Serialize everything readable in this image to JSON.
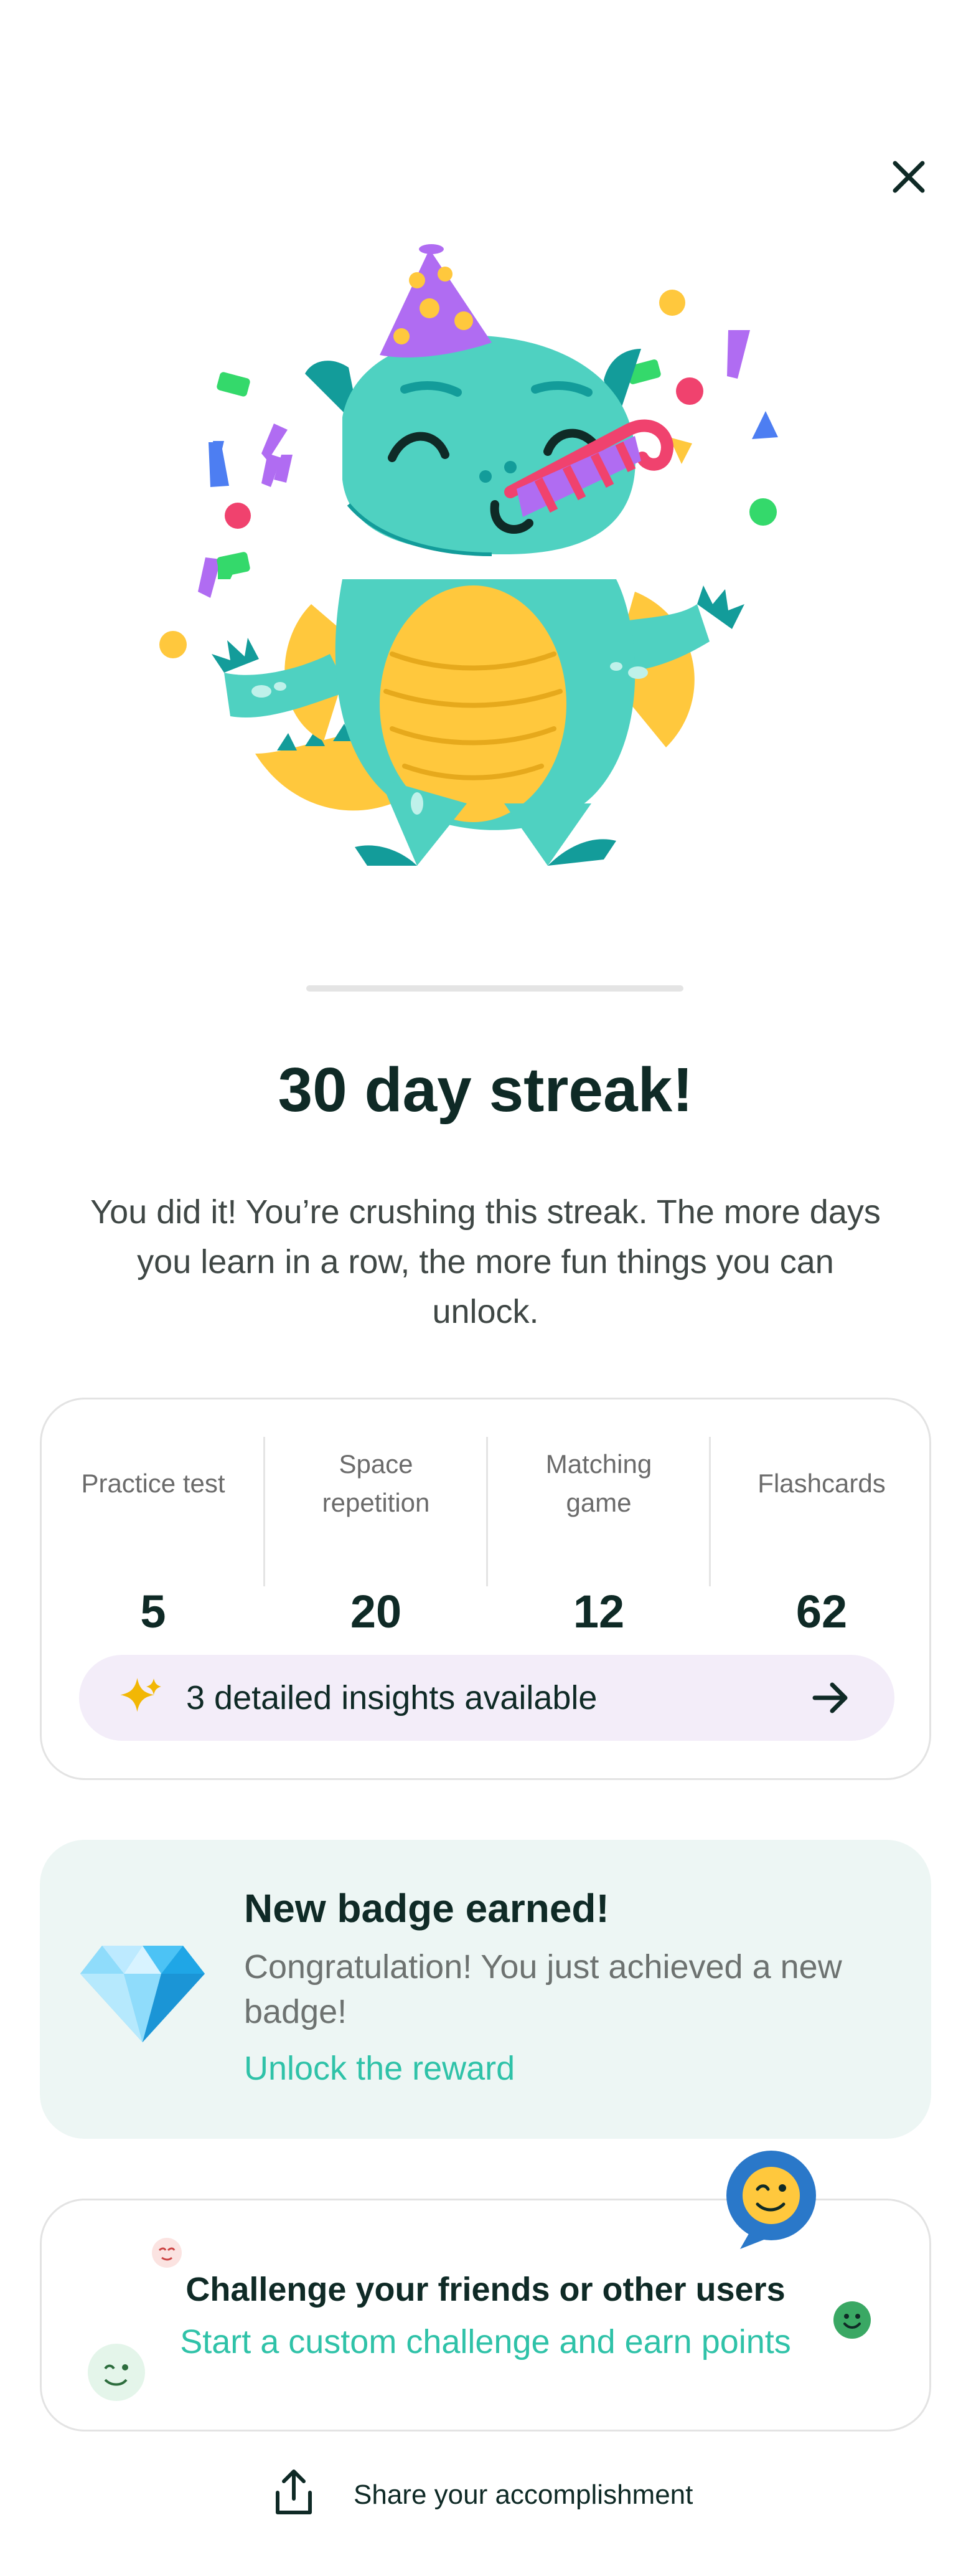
{
  "screen": {
    "title": "30 day streak!",
    "subtitle": "You did it! You’re crushing this streak. The more days you learn in a row, the more fun things you can unlock."
  },
  "icons": {
    "close": "close-icon",
    "mascot": "party-dragon-illustration",
    "sparkle": "sparkles-icon",
    "arrow": "arrow-right-icon",
    "gem": "diamond-icon",
    "share": "share-icon"
  },
  "stats": [
    {
      "label": "Practice test",
      "value": "5"
    },
    {
      "label": "Space repetition",
      "value": "20"
    },
    {
      "label": "Matching game",
      "value": "12"
    },
    {
      "label": "Flashcards",
      "value": "62"
    }
  ],
  "insights": {
    "label": "3 detailed insights available"
  },
  "badge": {
    "heading": "New badge earned!",
    "body": "Congratulation! You just achieved a new badge!",
    "link": "Unlock the reward"
  },
  "challenge": {
    "heading": "Challenge your friends or other users",
    "sub": "Start a custom challenge and earn points"
  },
  "share": {
    "label": "Share your accomplishment"
  },
  "colors": {
    "accent_teal": "#2fc2a8",
    "mascot_teal": "#4fd1c1",
    "mascot_dark": "#139c9a",
    "belly_yellow": "#ffc83d",
    "hat_purple": "#b06cf2",
    "insights_bg": "#f3edf9",
    "badge_bg": "#edf6f4",
    "text_dark": "#0f2a26"
  }
}
